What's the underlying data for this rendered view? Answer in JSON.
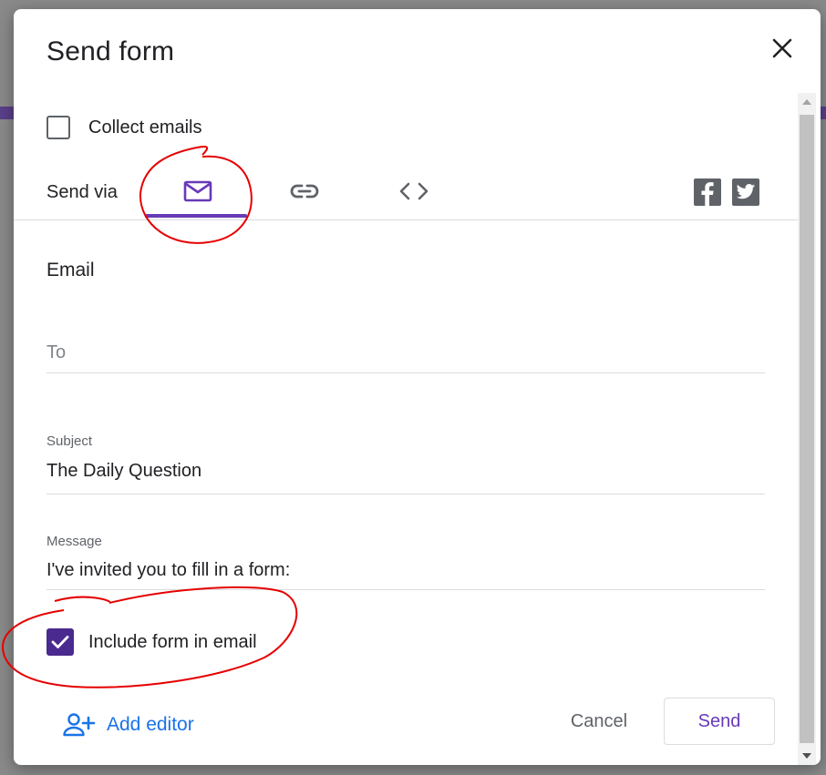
{
  "dialog": {
    "title": "Send form",
    "collect_emails_label": "Collect emails",
    "send_via_label": "Send via",
    "tabs": [
      {
        "name": "email",
        "icon": "mail-icon",
        "selected": true
      },
      {
        "name": "link",
        "icon": "link-icon",
        "selected": false
      },
      {
        "name": "embed",
        "icon": "code-icon",
        "selected": false
      }
    ],
    "social": [
      {
        "name": "facebook",
        "icon": "facebook-icon"
      },
      {
        "name": "twitter",
        "icon": "twitter-icon"
      }
    ],
    "email_section": {
      "title": "Email",
      "to_placeholder": "To",
      "subject_label": "Subject",
      "subject_value": "The Daily Question",
      "message_label": "Message",
      "message_value": "I've invited you to fill in a form:",
      "include_form_label": "Include form in email",
      "include_form_checked": true
    },
    "footer": {
      "add_editor_label": "Add editor",
      "cancel_label": "Cancel",
      "send_label": "Send"
    }
  },
  "colors": {
    "accent": "#673ab7",
    "checkbox_checked": "#4a2a8f",
    "link_blue": "#1a73e8",
    "annotation_red": "#e60000"
  }
}
